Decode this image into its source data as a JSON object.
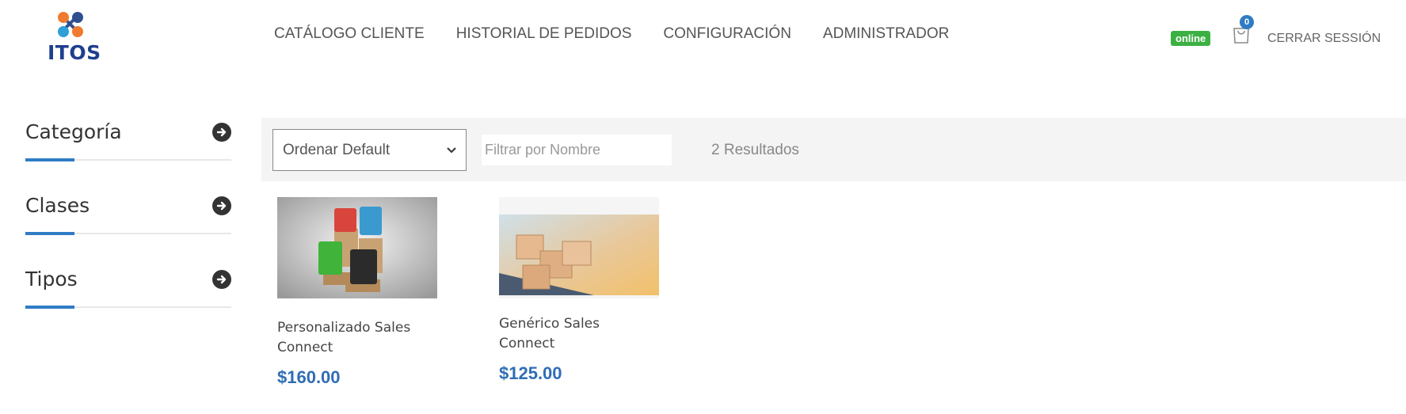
{
  "brand": {
    "name": "ITOS"
  },
  "nav": {
    "items": [
      {
        "label": "CATÁLOGO CLIENTE"
      },
      {
        "label": "HISTORIAL DE PEDIDOS"
      },
      {
        "label": "CONFIGURACIÓN"
      },
      {
        "label": "ADMINISTRADOR"
      }
    ]
  },
  "header": {
    "status_label": "online",
    "cart_count": "0",
    "logout_label": "CERRAR SESSIÓN"
  },
  "sidebar": {
    "items": [
      {
        "label": "Categoría"
      },
      {
        "label": "Clases"
      },
      {
        "label": "Tipos"
      }
    ]
  },
  "toolbar": {
    "sort_value": "Ordenar Default",
    "filter_placeholder": "Filtrar por Nombre",
    "filter_value": "",
    "results_label": "2 Resultados"
  },
  "products": [
    {
      "name": "Personalizado Sales Connect",
      "price": "$160.00"
    },
    {
      "name": "Genérico Sales Connect",
      "price": "$125.00"
    }
  ],
  "colors": {
    "accent": "#2f7cc4",
    "price": "#2f6db5",
    "online": "#3cb043",
    "brand": "#1f3f8f"
  }
}
